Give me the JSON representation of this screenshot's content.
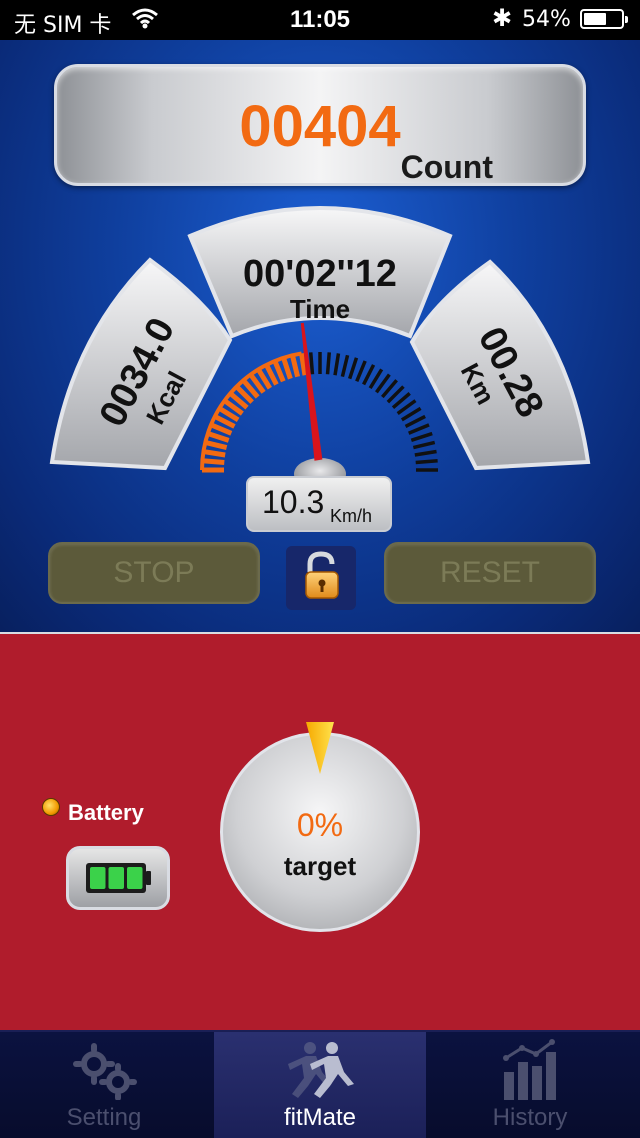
{
  "status_bar": {
    "carrier": "无 SIM 卡",
    "time": "11:05",
    "battery_percent": "54%",
    "icons": [
      "wifi-icon",
      "bluetooth-icon",
      "battery-icon"
    ],
    "battery_level": 0.54
  },
  "counter": {
    "value": "00404",
    "label": "Count"
  },
  "stats": {
    "calories": {
      "value": "0034.0",
      "unit": "Kcal"
    },
    "time": {
      "value": "00'02''12",
      "label": "Time"
    },
    "distance": {
      "value": "00.28",
      "unit": "Km"
    }
  },
  "speed": {
    "value": "10.3",
    "unit": "Km/h",
    "gauge_fraction": 0.45
  },
  "controls": {
    "stop_label": "STOP",
    "reset_label": "RESET",
    "lock_icon": "unlocked-padlock-icon"
  },
  "battery": {
    "label": "Battery",
    "level_bars": 3,
    "max_bars": 3
  },
  "target": {
    "percent": "0%",
    "label": "target"
  },
  "tabs": [
    {
      "label": "Setting",
      "icon": "gears-icon",
      "active": false
    },
    {
      "label": "fitMate",
      "icon": "runner-icon",
      "active": true
    },
    {
      "label": "History",
      "icon": "bar-chart-icon",
      "active": false
    }
  ],
  "colors": {
    "accent_orange": "#f26a12",
    "panel_blue": "#0f3f9e",
    "panel_red": "#b01c2c",
    "needle_red": "#d8141c",
    "battery_green": "#3bd24a"
  }
}
